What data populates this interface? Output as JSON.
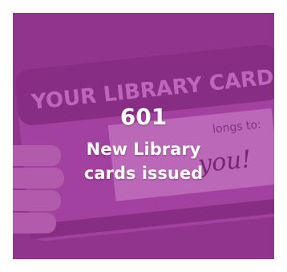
{
  "background_art": {
    "card_heading": "YOUR LIBRARY CARD",
    "card_belongs_text": "longs to:",
    "card_handwriting": "you!"
  },
  "stat": {
    "value": "601",
    "label_line1": "New Library",
    "label_line2": "cards issued"
  },
  "colors": {
    "overlay": "#b02aaa",
    "tile_base": "#8e3e8d",
    "text": "#ffffff"
  }
}
